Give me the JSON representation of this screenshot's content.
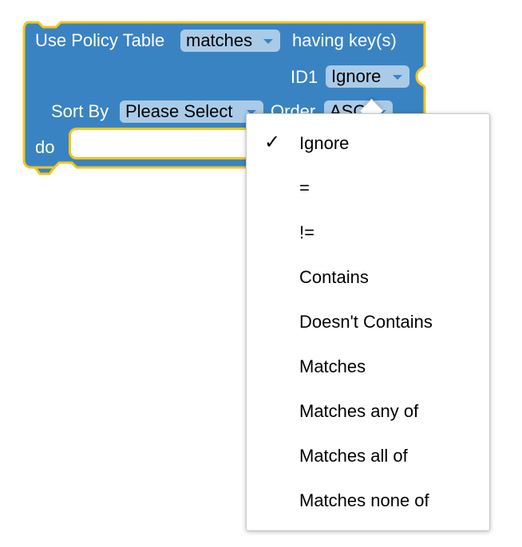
{
  "colors": {
    "block_fill": "#3a83c3",
    "block_outline": "#f5c518",
    "field_fill": "#a9cbe8",
    "caret": "#3a83c3"
  },
  "block": {
    "title_label": "Use Policy Table",
    "table_dropdown": "matches",
    "having_keys_label": "having key(s)",
    "key_name": "ID1",
    "key_operator": "Ignore",
    "sort_by_label": "Sort By",
    "sort_by_value": "Please Select",
    "order_label": "Order",
    "order_value": "ASC",
    "do_label": "do"
  },
  "dropdown": {
    "selected_index": 0,
    "check_glyph": "✓",
    "items": [
      {
        "label": "Ignore"
      },
      {
        "label": "="
      },
      {
        "label": "!="
      },
      {
        "label": "Contains"
      },
      {
        "label": "Doesn't Contains"
      },
      {
        "label": "Matches"
      },
      {
        "label": "Matches any of"
      },
      {
        "label": "Matches all of"
      },
      {
        "label": "Matches none of"
      }
    ]
  }
}
